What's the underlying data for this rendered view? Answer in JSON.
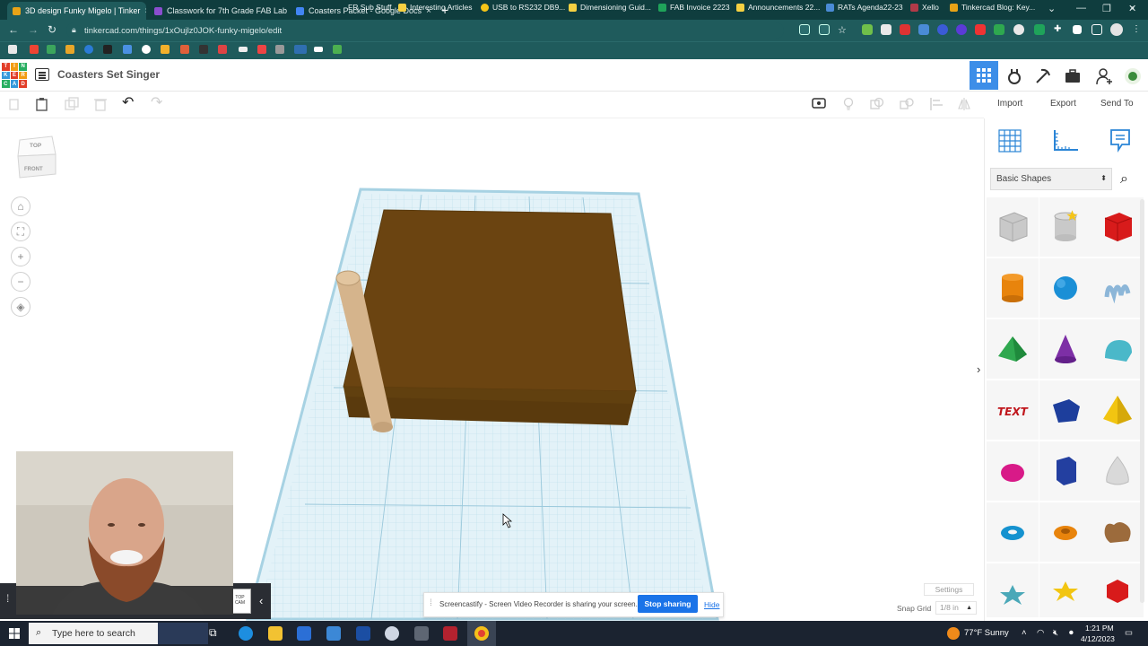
{
  "browser": {
    "tabs": [
      {
        "title": "3D design Funky Migelo | Tinker",
        "color": "#e8a317",
        "active": true
      },
      {
        "title": "Classwork for 7th Grade FAB Lab",
        "color": "#8a4ecf",
        "active": false
      },
      {
        "title": "Coasters Packet - Google Docs",
        "color": "#4285f4",
        "active": false
      }
    ],
    "url": "tinkercad.com/things/1xOujlz0JOK-funky-migelo/edit",
    "bookmarks": [
      "FR Sub Stuff",
      "Interesting Articles",
      "USB to RS232 DB9...",
      "Dimensioning Guid...",
      "FAB Invoice 2223",
      "Announcements 22...",
      "RATs Agenda22-23",
      "Xello",
      "Tinkercad Blog: Key..."
    ]
  },
  "app": {
    "logo_letters": [
      "TIN",
      "KER",
      "CAD"
    ],
    "design_title": "Coasters Set Singer",
    "toolbar": {
      "import": "Import",
      "export": "Export",
      "send_to": "Send To"
    },
    "viewcube": {
      "top": "TOP",
      "front": "FRONT"
    },
    "panel": {
      "library": "Basic Shapes"
    },
    "settings": "Settings",
    "snap_grid_label": "Snap Grid",
    "snap_grid_value": "1/8 in",
    "share_bar": {
      "text": "Screencastify - Screen Video Recorder is sharing your screen.",
      "stop": "Stop sharing",
      "hide": "Hide"
    },
    "webcam_badge": "TOP\nCAM"
  },
  "taskbar": {
    "search_placeholder": "Type here to search",
    "weather": "77°F  Sunny",
    "time": "1:21 PM",
    "date": "4/12/2023"
  },
  "colors": {
    "accent": "#3d8ee8",
    "chrome": "#1f5b5c",
    "block": "#6b4411",
    "plate": "#d8eef7"
  }
}
